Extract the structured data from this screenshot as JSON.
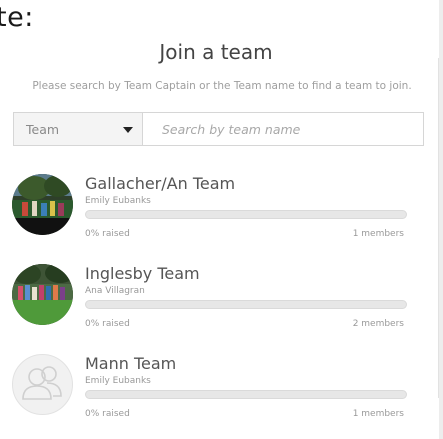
{
  "page_fragment_text": "te:",
  "modal": {
    "title": "Join a team",
    "instructions": "Please search by Team Captain or the Team name to find a team to join."
  },
  "search": {
    "select_value": "Team",
    "placeholder": "Search by team name"
  },
  "teams": [
    {
      "name": "Gallacher/An Team",
      "captain": "Emily Eubanks",
      "raised_text": "0% raised",
      "raised_fraction": 0,
      "members_text": "1 members",
      "avatar": "team-photo"
    },
    {
      "name": "Inglesby Team",
      "captain": "Ana Villagran",
      "raised_text": "0% raised",
      "raised_fraction": 0,
      "members_text": "2 members",
      "avatar": "team-photo"
    },
    {
      "name": "Mann Team",
      "captain": "Emily Eubanks",
      "raised_text": "0% raised",
      "raised_fraction": 0,
      "members_text": "1 members",
      "avatar": "group-placeholder-icon"
    }
  ],
  "colors": {
    "progress_fill": "#6bb24b",
    "progress_track": "#e7e7e7",
    "placeholder_text": "#a8a8a8"
  }
}
